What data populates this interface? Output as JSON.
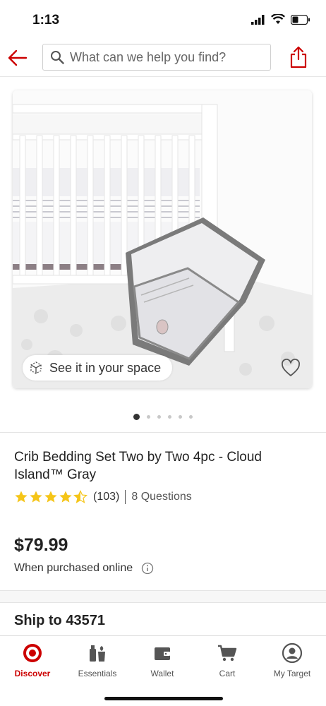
{
  "status_bar": {
    "time": "1:13"
  },
  "header": {
    "search_placeholder": "What can we help you find?",
    "accent_color": "#cc0000"
  },
  "gallery": {
    "see_in_space_label": "See it in your space",
    "image_count": 6,
    "active_index": 0
  },
  "product": {
    "title": "Crib Bedding Set Two by Two 4pc - Cloud Island™ Gray",
    "rating": 4.5,
    "rating_max": 5,
    "rating_count": "(103)",
    "questions": "8 Questions",
    "price": "$79.99",
    "price_note": "When purchased online"
  },
  "shipping": {
    "label": "Ship to 43571"
  },
  "bottom_nav": [
    {
      "label": "Discover",
      "icon": "target-bullseye-icon",
      "active": true
    },
    {
      "label": "Essentials",
      "icon": "essentials-bottles-icon",
      "active": false
    },
    {
      "label": "Wallet",
      "icon": "wallet-icon",
      "active": false
    },
    {
      "label": "Cart",
      "icon": "cart-icon",
      "active": false
    },
    {
      "label": "My Target",
      "icon": "account-icon",
      "active": false
    }
  ],
  "colors": {
    "star": "#f5c518",
    "brand_red": "#cc0000"
  }
}
